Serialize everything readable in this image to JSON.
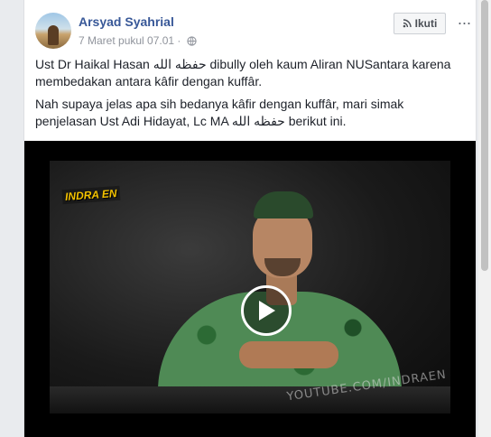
{
  "post": {
    "author_name": "Arsyad Syahrial",
    "timestamp": "7 Maret pukul 07.01",
    "separator": "·",
    "privacy_icon": "globe-icon",
    "follow_label": "Ikuti",
    "follow_icon": "rss-icon",
    "more_icon": "more-icon",
    "more_label": "···",
    "paragraphs": [
      "Ust Dr Haikal Hasan حفظه الله dibully oleh kaum Aliran NUSantara karena membedakan antara kâfir dengan kuffâr.",
      "Nah supaya jelas apa sih bedanya kâfir dengan kuffâr, mari simak penjelasan Ust Adi Hidayat, Lc MA حفظه الله berikut ini."
    ]
  },
  "video": {
    "overlay_logo": "INDRA EN",
    "overlay_watermark": "YOUTUBE.COM/INDRAEN",
    "play_icon": "play-icon"
  },
  "colors": {
    "name": "#385898",
    "meta": "#90949c",
    "text": "#1d2129",
    "background": "#e9ebee"
  }
}
